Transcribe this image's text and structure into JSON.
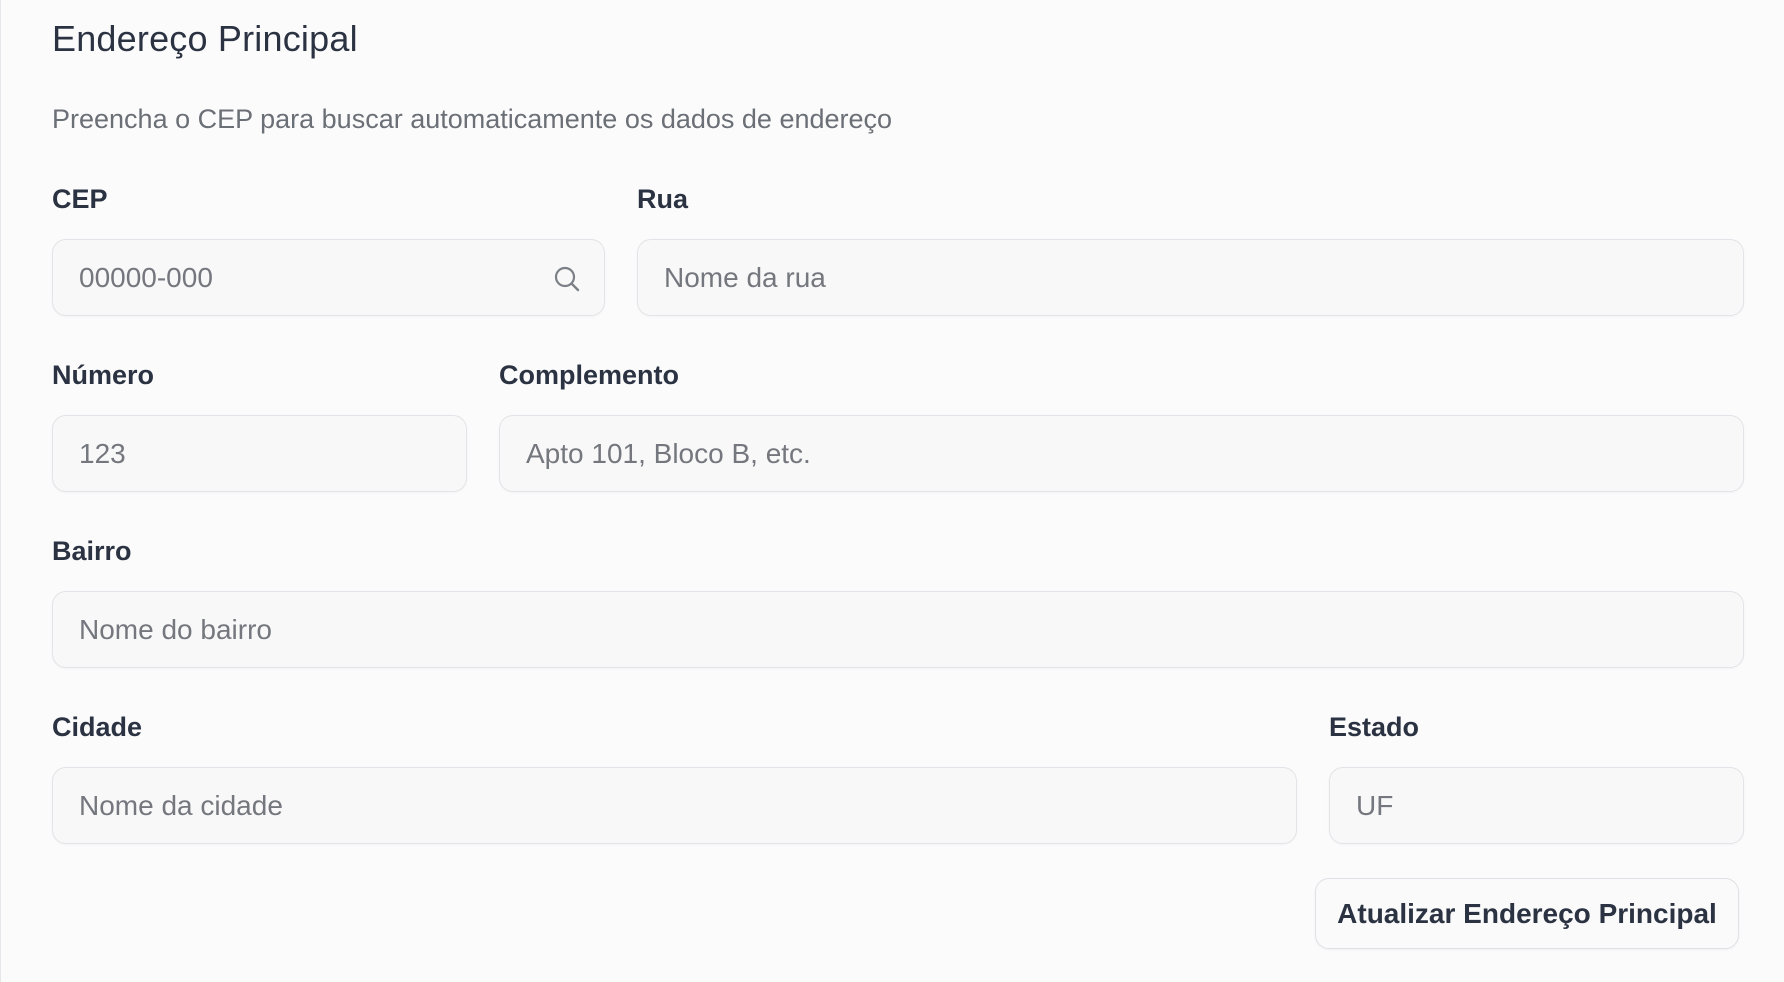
{
  "section": {
    "title": "Endereço Principal",
    "subtitle": "Preencha o CEP para buscar automaticamente os dados de endereço"
  },
  "fields": {
    "cep": {
      "label": "CEP",
      "placeholder": "00000-000",
      "value": ""
    },
    "rua": {
      "label": "Rua",
      "placeholder": "Nome da rua",
      "value": ""
    },
    "numero": {
      "label": "Número",
      "placeholder": "123",
      "value": ""
    },
    "complemento": {
      "label": "Complemento",
      "placeholder": "Apto 101, Bloco B, etc.",
      "value": ""
    },
    "bairro": {
      "label": "Bairro",
      "placeholder": "Nome do bairro",
      "value": ""
    },
    "cidade": {
      "label": "Cidade",
      "placeholder": "Nome da cidade",
      "value": ""
    },
    "estado": {
      "label": "Estado",
      "placeholder": "UF",
      "value": ""
    }
  },
  "actions": {
    "submit_label": "Atualizar Endereço Principal"
  },
  "icons": {
    "cep_search": "search-icon"
  }
}
